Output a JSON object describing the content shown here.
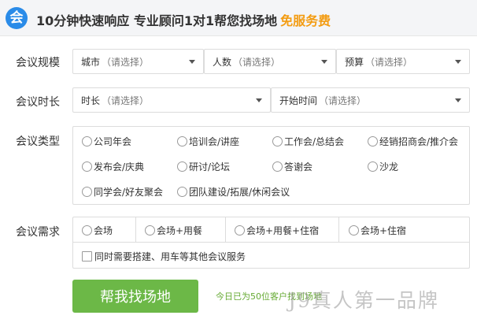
{
  "header": {
    "logo_glyph": "会",
    "headline": "10分钟快速响应 专业顾问1对1帮您找场地",
    "free_label": "免服务费"
  },
  "rows": {
    "scale": {
      "label": "会议规模",
      "selects": [
        {
          "name": "城市",
          "placeholder": "（请选择）"
        },
        {
          "name": "人数",
          "placeholder": "（请选择）"
        },
        {
          "name": "预算",
          "placeholder": "（请选择）"
        }
      ]
    },
    "duration": {
      "label": "会议时长",
      "selects": [
        {
          "name": "时长",
          "placeholder": "（请选择）"
        },
        {
          "name": "开始时间",
          "placeholder": "（请选择）"
        }
      ]
    },
    "type": {
      "label": "会议类型",
      "options": [
        "公司年会",
        "培训会/讲座",
        "工作会/总结会",
        "经销招商会/推介会",
        "发布会/庆典",
        "研讨/论坛",
        "答谢会",
        "沙龙",
        "同学会/好友聚会",
        "团队建设/拓展/休闲会议"
      ]
    },
    "needs": {
      "label": "会议需求",
      "options": [
        "会场",
        "会场+用餐",
        "会场+用餐+住宿",
        "会场+住宿"
      ],
      "extra_checkbox": "同时需要搭建、用车等其他会议服务"
    }
  },
  "cta": {
    "button": "帮我找场地",
    "stat": "今日已为50位客户找到场地"
  },
  "watermark": "J9真人第一品牌"
}
